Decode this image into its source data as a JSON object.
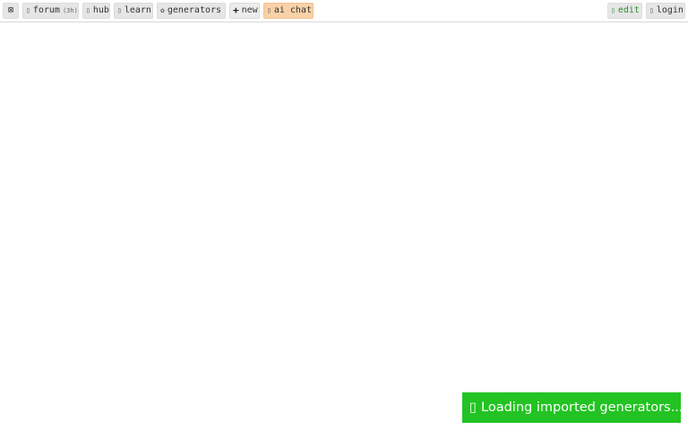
{
  "topbar": {
    "collapse_icon": "⊠",
    "forum": {
      "icon": "comments-icon",
      "label": "forum",
      "badge": "(3h)"
    },
    "hub": {
      "icon": "compass-icon",
      "label": "hub"
    },
    "learn": {
      "icon": "book-icon",
      "label": "learn"
    },
    "generators": {
      "icon": "sparkle-icon",
      "glyph": "✿",
      "label": "generators"
    },
    "new": {
      "icon": "plus-icon",
      "glyph": "+",
      "label": "new"
    },
    "ai_chat": {
      "icon": "robot-icon",
      "label": "ai chat"
    },
    "edit": {
      "icon": "pencil-icon",
      "label": "edit"
    },
    "login": {
      "icon": "user-icon",
      "label": "login"
    }
  },
  "status": {
    "icon": "spinner-icon",
    "message": "Loading imported generators..."
  },
  "colors": {
    "loading_bg": "#22c322",
    "ai_chat_bg": "#f9d1a8",
    "edit_text": "#2e8b2e"
  }
}
